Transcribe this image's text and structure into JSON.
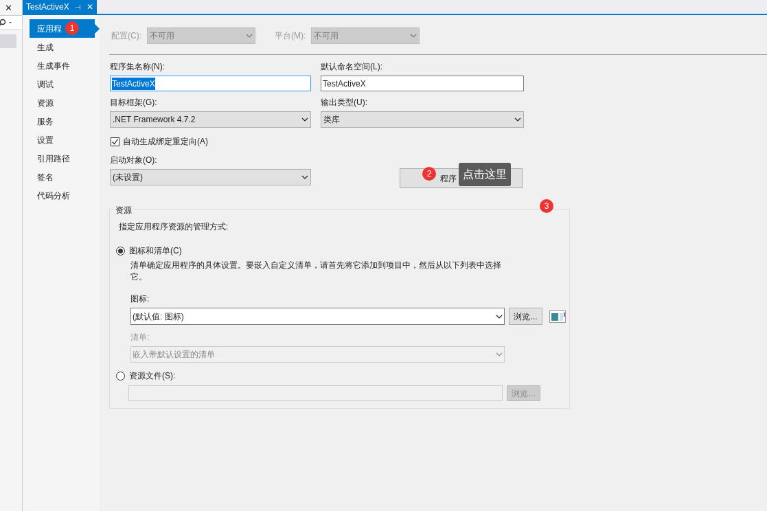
{
  "left_panel": {
    "close": "✕"
  },
  "tab": {
    "title": "TestActiveX",
    "pin": "⊣",
    "close": "✕",
    "selected": true
  },
  "sidebar": {
    "items": [
      {
        "label": "应用程",
        "selected": true,
        "badge": "1"
      },
      {
        "label": "生成",
        "selected": false
      },
      {
        "label": "生成事件",
        "selected": false
      },
      {
        "label": "调试",
        "selected": false
      },
      {
        "label": "资源",
        "selected": false
      },
      {
        "label": "服务",
        "selected": false
      },
      {
        "label": "设置",
        "selected": false
      },
      {
        "label": "引用路径",
        "selected": false
      },
      {
        "label": "签名",
        "selected": false
      },
      {
        "label": "代码分析",
        "selected": false
      }
    ]
  },
  "config": [
    {
      "label": "配置(C):",
      "value": "不可用",
      "disabled": true
    },
    {
      "label": "平台(M):",
      "value": "不可用",
      "disabled": true
    }
  ],
  "fields": [
    {
      "kind": "text",
      "label": "程序集名称(N):",
      "value": "TestActiveX",
      "focused": true
    },
    {
      "kind": "text",
      "label": "默认命名空间(L):",
      "value": "TestActiveX",
      "focused": false
    },
    {
      "kind": "select",
      "label": "目标框架(G):",
      "value": ".NET Framework 4.7.2"
    },
    {
      "kind": "select",
      "label": "输出类型(U):",
      "value": "类库"
    }
  ],
  "auto_redirect": {
    "label": "自动生成绑定重定向(A)",
    "checked": true
  },
  "startup": {
    "label": "启动对象(O):",
    "value": "(未设置)"
  },
  "assembly_button": {
    "label": "程序",
    "badge": "2",
    "tooltip": "点击这里"
  },
  "resources": {
    "title": "资源",
    "badge": "3",
    "description": "指定应用程序资源的管理方式:",
    "options": [
      {
        "label": "图标和清单(C)",
        "selected": true,
        "note": "清单确定应用程序的具体设置。要嵌入自定义清单，请首先将它添加到项目中，然后从以下列表中选择它。",
        "icon_label": "图标:",
        "icon_value": "(默认值: 图标)",
        "browse": "浏览...",
        "manifest_label": "清单:",
        "manifest_value": "嵌入带默认设置的清单"
      },
      {
        "label": "资源文件(S):",
        "selected": false,
        "browse": "浏览..."
      }
    ]
  }
}
